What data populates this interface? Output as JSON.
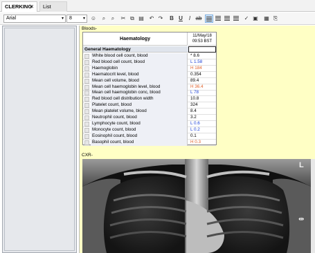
{
  "tabs": [
    {
      "label": "CLERKING",
      "close": "✕"
    },
    {
      "label": "List"
    }
  ],
  "toolbar": {
    "font": "Arial",
    "size": "8",
    "dropdown_arrow": "▾"
  },
  "document": {
    "bloods_label": "Bloods-",
    "cxr_label": "CXR-",
    "results": {
      "title": "Haematology",
      "date": "11/May/18",
      "time": "09:53 BST",
      "group": "General Haematology",
      "rows": [
        {
          "name": "White blood cell count, blood",
          "value": "* 8.6",
          "flag": "none"
        },
        {
          "name": "Red blood cell count, blood",
          "value": "L 1.58",
          "flag": "low"
        },
        {
          "name": "Haemoglobin",
          "value": "H 184",
          "flag": "high"
        },
        {
          "name": "Haematocrit level, blood",
          "value": "0.354",
          "flag": "none"
        },
        {
          "name": "Mean cell volume, blood",
          "value": "89.4",
          "flag": "none"
        },
        {
          "name": "Mean cell haemoglobin level, blood",
          "value": "H 36.4",
          "flag": "high"
        },
        {
          "name": "Mean cell haemoglobin conc, blood",
          "value": "L 78",
          "flag": "low"
        },
        {
          "name": "Red blood cell distribution width",
          "value": "10.8",
          "flag": "none"
        },
        {
          "name": "Platelet count, blood",
          "value": "324",
          "flag": "none"
        },
        {
          "name": "Mean platelet volume, blood",
          "value": "8.4",
          "flag": "none"
        },
        {
          "name": "Neutrophil count, blood",
          "value": "3.2",
          "flag": "none"
        },
        {
          "name": "Lymphocyte count, blood",
          "value": "L 0.6",
          "flag": "low"
        },
        {
          "name": "Monocyte count, blood",
          "value": "L 0.2",
          "flag": "low"
        },
        {
          "name": "Eosinophil count, blood",
          "value": "0.1",
          "flag": "none"
        },
        {
          "name": "Basophil count, blood",
          "value": "H 0.3",
          "flag": "high"
        }
      ]
    },
    "xray_marker": "L"
  },
  "colors": {
    "low": "#1a3fd6",
    "high": "#e0602a",
    "none": "#000000",
    "doc_background": "#ffffc5"
  }
}
